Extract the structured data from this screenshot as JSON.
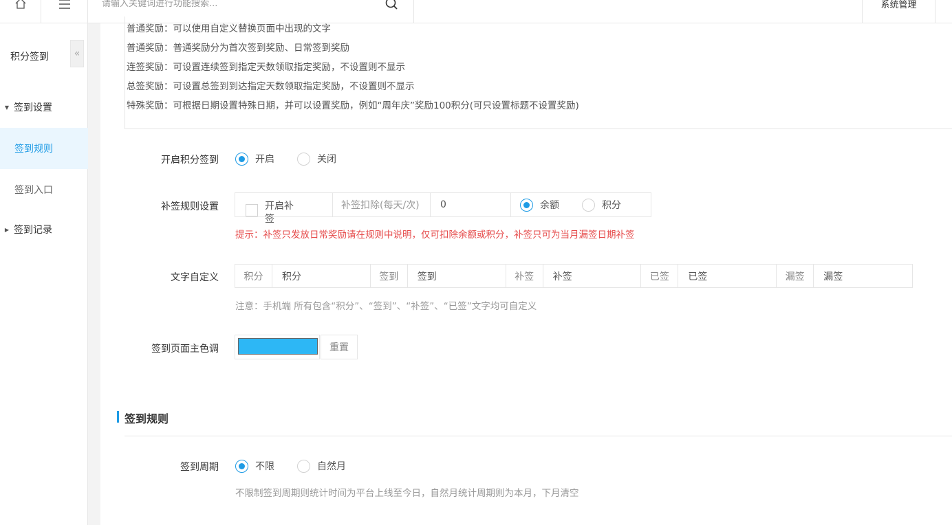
{
  "topbar": {
    "home_icon": "home-icon",
    "menu_icon": "hamburger-menu-icon",
    "search_placeholder": "请输入关键词进行功能搜索...",
    "search_icon": "search-icon",
    "system_label": "系统管理"
  },
  "sidebar": {
    "title": "积分签到",
    "collapse_glyph": "«",
    "groups": [
      {
        "label": "签到设置",
        "expanded": true,
        "items": [
          {
            "label": "签到规则",
            "active": true
          },
          {
            "label": "签到入口",
            "active": false
          }
        ]
      },
      {
        "label": "签到记录",
        "expanded": false
      }
    ]
  },
  "description": {
    "lines": [
      "普通奖励：可以使用自定义替换页面中出现的文字",
      "普通奖励：普通奖励分为首次签到奖励、日常签到奖励",
      "连签奖励：可设置连续签到指定天数领取指定奖励，不设置则不显示",
      "总签奖励：可设置总签到到达指定天数领取指定奖励，不设置则不显示",
      "特殊奖励：可根据日期设置特殊日期，并可以设置奖励，例如“周年庆”奖励100积分(可只设置标题不设置奖励)"
    ]
  },
  "form": {
    "enable_signin": {
      "label": "开启积分签到",
      "options": [
        "开启",
        "关闭"
      ],
      "selected": "开启"
    },
    "makeup_rule": {
      "label": "补签规则设置",
      "checkbox_label": "开启补签",
      "checked": false,
      "deduct_label": "补签扣除(每天/次)",
      "deduct_value": "0",
      "options": [
        "余额",
        "积分"
      ],
      "selected": "余额",
      "hint": "提示：补签只发放日常奖励请在规则中说明，仅可扣除余额或积分，补签只可为当月漏签日期补签"
    },
    "text_custom": {
      "label": "文字自定义",
      "fields": [
        {
          "addon": "积分",
          "value": "积分"
        },
        {
          "addon": "签到",
          "value": "签到"
        },
        {
          "addon": "补签",
          "value": "补签"
        },
        {
          "addon": "已签",
          "value": "已签"
        },
        {
          "addon": "漏签",
          "value": "漏签"
        }
      ],
      "note": "注意：手机端 所有包含“积分”、“签到”、“补签”、“已签”文字均可自定义"
    },
    "theme_color": {
      "label": "签到页面主色调",
      "color": "#2db7f5",
      "reset_label": "重置"
    }
  },
  "rules_section": {
    "title": "签到规则",
    "accent_color": "#1e9be5",
    "cycle": {
      "label": "签到周期",
      "options": [
        "不限",
        "自然月"
      ],
      "selected": "不限",
      "note": "不限制签到周期则统计时间为平台上线至今日，自然月统计周期则为本月，下月清空"
    }
  }
}
